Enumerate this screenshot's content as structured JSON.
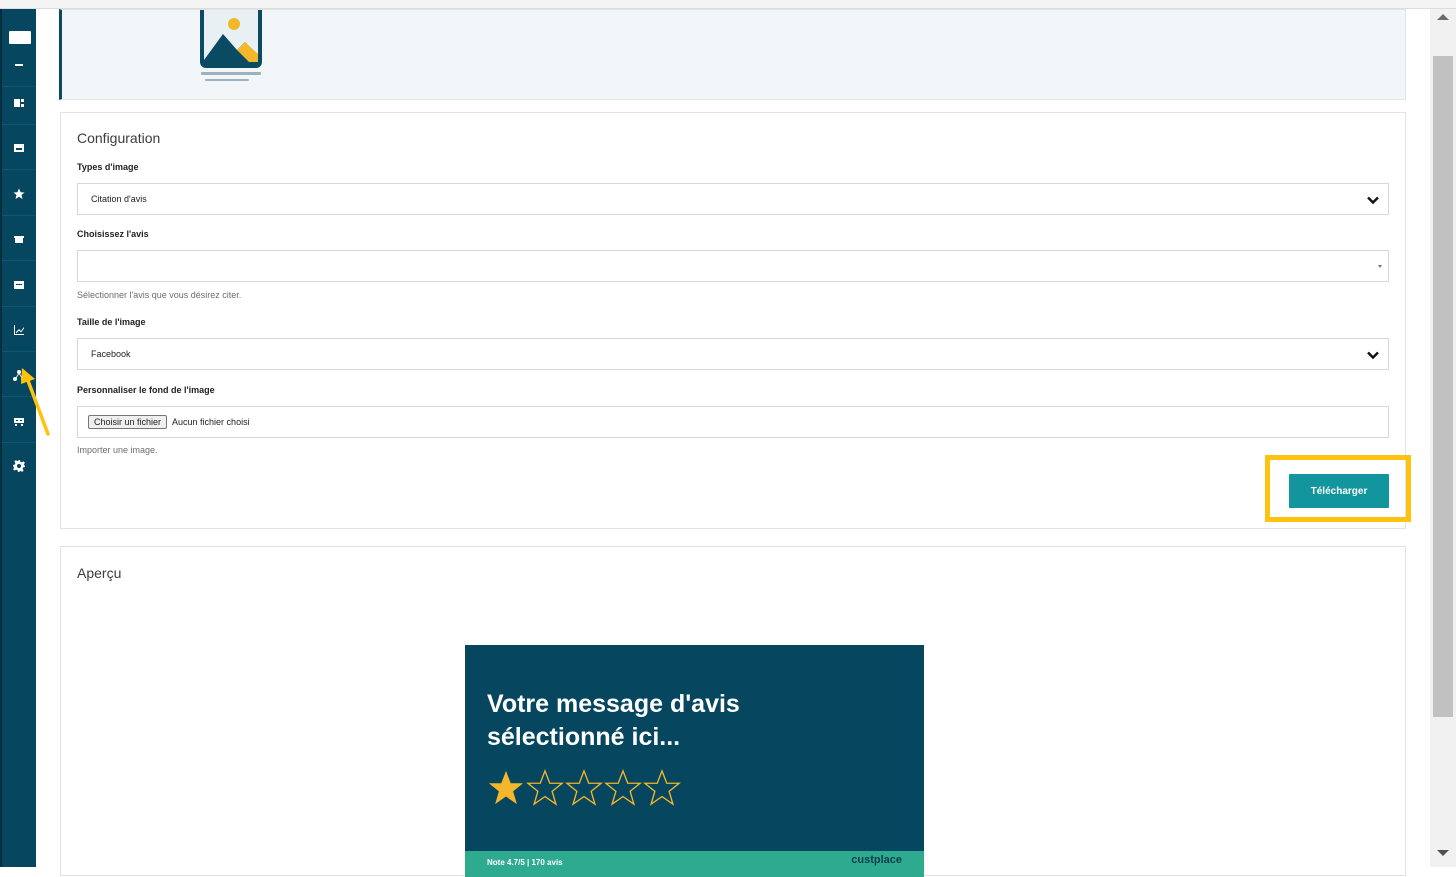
{
  "sidebar": {
    "items": [
      {
        "name": "logo"
      },
      {
        "icon": "minus-icon"
      },
      {
        "icon": "layout-icon"
      },
      {
        "icon": "inbox-icon"
      },
      {
        "icon": "star-icon"
      },
      {
        "icon": "store-icon"
      },
      {
        "icon": "message-icon"
      },
      {
        "icon": "chart-icon"
      },
      {
        "icon": "share-icon"
      },
      {
        "icon": "robot-icon"
      },
      {
        "icon": "gear-icon"
      }
    ]
  },
  "configuration": {
    "title": "Configuration",
    "image_type_label": "Types d'image",
    "image_type_value": "Citation d'avis",
    "review_label": "Choisissez l'avis",
    "review_value": "",
    "review_help": "Sélectionner l'avis que vous désirez citer.",
    "size_label": "Taille de l'image",
    "size_value": "Facebook",
    "background_label": "Personnaliser le fond de l'image",
    "file_button": "Choisir un fichier",
    "file_status": "Aucun fichier choisi",
    "background_help": "Importer une image.",
    "download_button": "Télécharger"
  },
  "apercu": {
    "title": "Aperçu",
    "preview_message": "Votre message d'avis sélectionné ici...",
    "rating": 1,
    "rating_max": 5,
    "footer_text": "Note 4.7/5 | 170 avis",
    "brand": "custplace"
  },
  "colors": {
    "sidebar": "#06465f",
    "accent": "#12959c",
    "highlight": "#ffc20e",
    "star": "#f2b72b",
    "footer": "#2eab8f"
  }
}
